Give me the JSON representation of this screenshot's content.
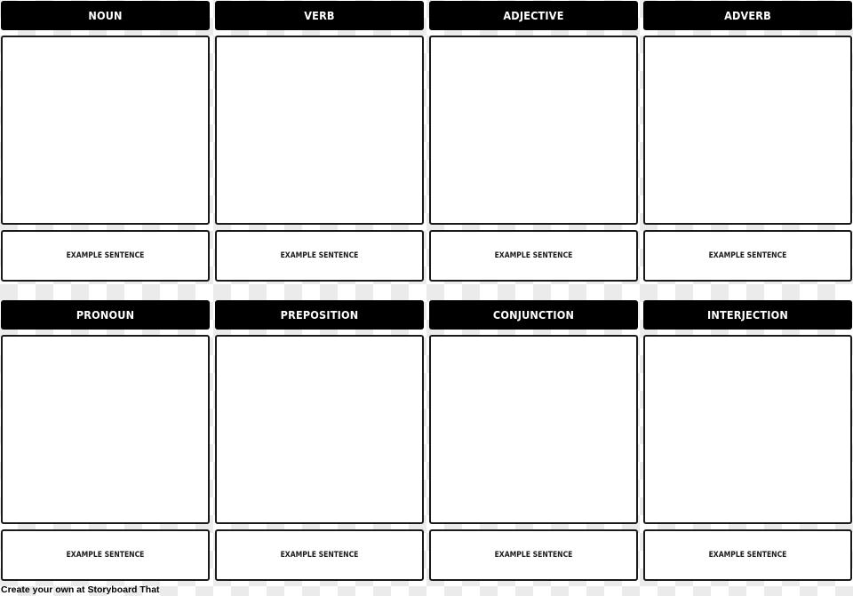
{
  "rows": [
    {
      "cells": [
        {
          "title": "NOUN",
          "sentence": "EXAMPLE SENTENCE"
        },
        {
          "title": "VERB",
          "sentence": "EXAMPLE SENTENCE"
        },
        {
          "title": "ADJECTIVE",
          "sentence": "EXAMPLE SENTENCE"
        },
        {
          "title": "ADVERB",
          "sentence": "EXAMPLE SENTENCE"
        }
      ]
    },
    {
      "cells": [
        {
          "title": "PRONOUN",
          "sentence": "EXAMPLE SENTENCE"
        },
        {
          "title": "PREPOSITION",
          "sentence": "EXAMPLE SENTENCE"
        },
        {
          "title": "CONJUNCTION",
          "sentence": "EXAMPLE SENTENCE"
        },
        {
          "title": "INTERJECTION",
          "sentence": "EXAMPLE SENTENCE"
        }
      ]
    }
  ],
  "footer": {
    "text": "Create your own at Storyboard That"
  },
  "colors": {
    "header_bg": "#000000",
    "header_text": "#ffffff",
    "border": "#1a1a1a",
    "checker": "#ebebeb"
  }
}
